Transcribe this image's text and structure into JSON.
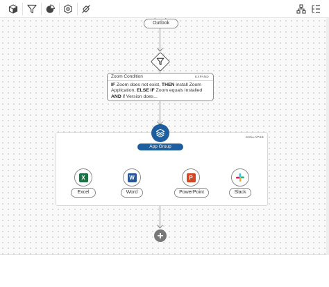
{
  "toolbar": {
    "left_icons": [
      "cube-icon",
      "filter-icon",
      "pie-chart-icon",
      "settings-box-icon",
      "no-plugin-icon"
    ],
    "right_icons": [
      "hierarchy-icon",
      "list-tree-icon"
    ]
  },
  "flow": {
    "top_node": {
      "label": "Outlook"
    },
    "condition": {
      "title": "Zoom Condition",
      "expand_label": "EXPAND",
      "body": {
        "t1": "IF",
        "t2": " Zoom does not exist, ",
        "t3": "THEN",
        "t4": " install Zoom Application, ",
        "t5": "ELSE IF",
        "t6": " Zoom equals Installed ",
        "t7": "AND",
        "t8": " if Version does..."
      }
    },
    "group": {
      "label": "App Group",
      "collapse_label": "COLLAPSE",
      "color": "#1d5f9e",
      "apps": [
        {
          "label": "Excel",
          "icon": "excel-icon",
          "color": "#1e7145"
        },
        {
          "label": "Word",
          "icon": "word-icon",
          "color": "#2b579a"
        },
        {
          "label": "PowerPoint",
          "icon": "powerpoint-icon",
          "color": "#d24726"
        },
        {
          "label": "Slack",
          "icon": "slack-icon",
          "color": "#4a154b"
        }
      ]
    },
    "add_button": {
      "icon": "plus-icon"
    }
  }
}
